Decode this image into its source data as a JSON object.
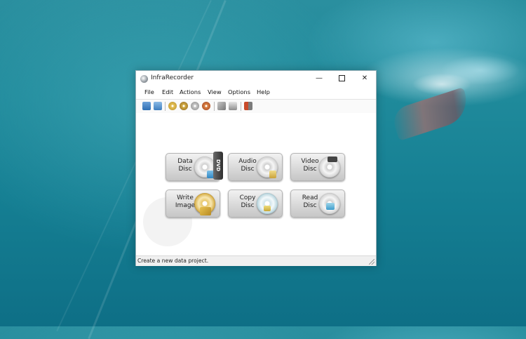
{
  "window": {
    "title": "InfraRecorder",
    "controls": {
      "minimize": "—",
      "close": "✕"
    }
  },
  "menu": [
    "File",
    "Edit",
    "Actions",
    "View",
    "Options",
    "Help"
  ],
  "toolbar_icons": [
    "new-project-icon",
    "open-project-icon",
    "burn-image-icon",
    "copy-disc-icon",
    "manage-tracks-icon",
    "erase-disc-icon",
    "tools-icon",
    "drive-icon",
    "exit-icon"
  ],
  "tiles": [
    {
      "line1": "Data",
      "line2": "Disc",
      "icon": "data-disc-icon"
    },
    {
      "line1": "Audio",
      "line2": "Disc",
      "icon": "audio-disc-icon"
    },
    {
      "line1": "Video",
      "line2": "Disc",
      "icon": "video-disc-icon"
    },
    {
      "line1": "Write",
      "line2": "Image",
      "icon": "write-image-icon"
    },
    {
      "line1": "Copy",
      "line2": "Disc",
      "icon": "copy-disc-icon"
    },
    {
      "line1": "Read",
      "line2": "Disc",
      "icon": "read-disc-icon"
    }
  ],
  "dvd_label": "DVD",
  "status": "Create a new data project.",
  "colors": {
    "tile_top": "#f2f2f2",
    "tile_bottom": "#c6c6c6",
    "desktop": "#1f8a9b"
  }
}
